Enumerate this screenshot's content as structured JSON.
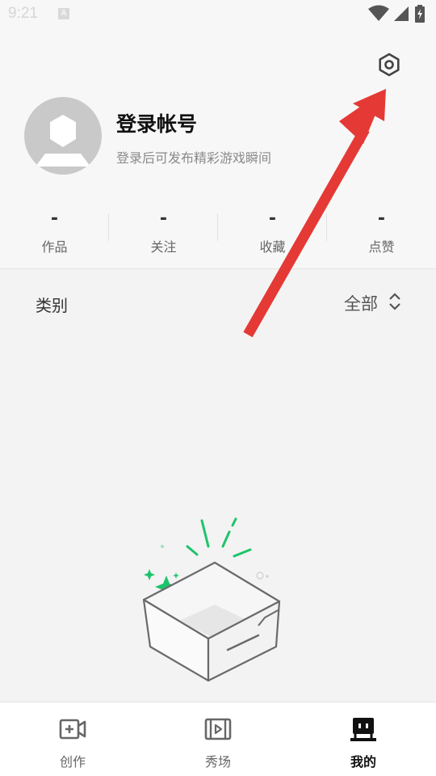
{
  "status_bar": {
    "time": "9:21",
    "indicator": "A",
    "icons": [
      "wifi-icon",
      "signal-icon",
      "battery-charging-icon"
    ]
  },
  "profile": {
    "title": "登录帐号",
    "subtitle": "登录后可发布精彩游戏瞬间",
    "stats": [
      {
        "value": "-",
        "label": "作品"
      },
      {
        "value": "-",
        "label": "关注"
      },
      {
        "value": "-",
        "label": "收藏"
      },
      {
        "value": "-",
        "label": "点赞"
      }
    ]
  },
  "category": {
    "label": "类别",
    "selected": "全部"
  },
  "bottom_nav": {
    "items": [
      {
        "label": "创作",
        "icon": "video-add-icon",
        "active": false
      },
      {
        "label": "秀场",
        "icon": "film-icon",
        "active": false
      },
      {
        "label": "我的",
        "icon": "profile-icon",
        "active": true
      }
    ]
  },
  "colors": {
    "annotation_arrow": "#e53935",
    "accent_green": "#1cc46a",
    "avatar_gray": "#c9c9c9"
  }
}
